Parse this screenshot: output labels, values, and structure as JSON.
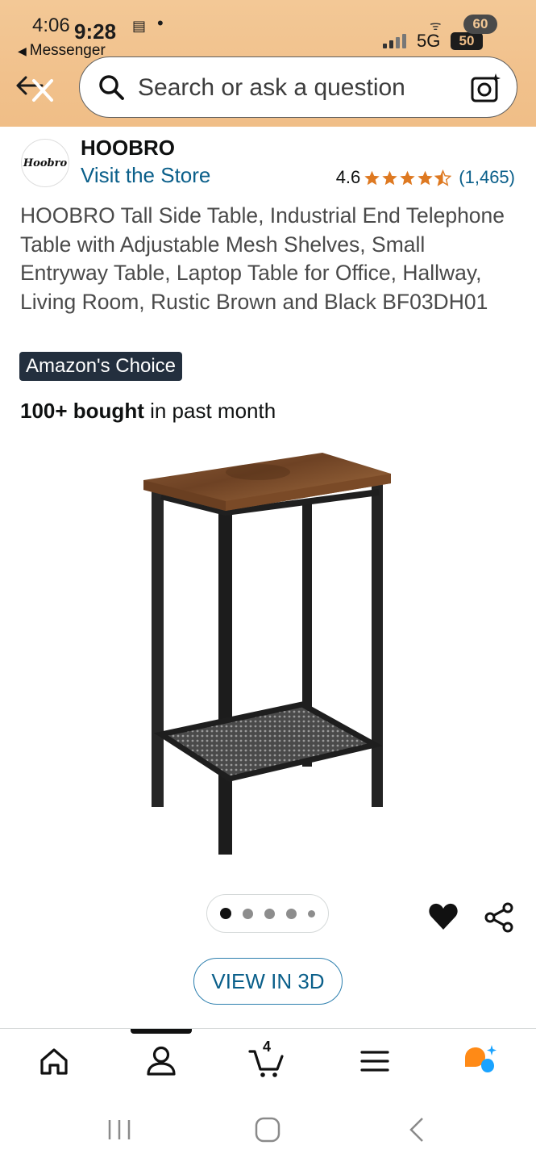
{
  "status_bar": {
    "time_background": "4:06",
    "time_overlay": "9:28",
    "back_app_label": "Messenger",
    "network_label": "5G",
    "battery_top": "60",
    "battery_bottom": "50"
  },
  "search": {
    "placeholder": "Search or ask a question"
  },
  "brand": {
    "logo_text": "Hoobro",
    "name": "HOOBRO",
    "store_link": "Visit the Store",
    "rating": "4.6",
    "stars": 4.5,
    "review_count": "(1,465)"
  },
  "product": {
    "title": "HOOBRO Tall Side Table, Industrial End Telephone Table with Adjustable Mesh Shelves, Small Entryway Table, Laptop Table for Office, Hallway, Living Room, Rustic Brown and Black BF03DH01",
    "badge": "Amazon's Choice",
    "bought_bold": "100+ bought",
    "bought_rest": " in past month",
    "image_icon": "side-table-image"
  },
  "gallery": {
    "dot_count": 5,
    "active_index": 0,
    "view_3d_label": "VIEW IN 3D"
  },
  "bottom_nav": {
    "items": [
      {
        "icon": "home-icon"
      },
      {
        "icon": "account-icon"
      },
      {
        "icon": "cart-icon",
        "count": "4"
      },
      {
        "icon": "menu-icon"
      },
      {
        "icon": "rufus-assistant-icon"
      }
    ],
    "active_index": 1
  },
  "colors": {
    "header_bg": "#f3c896",
    "link_blue": "#0a5f8a",
    "star_orange": "#de7921",
    "badge_bg": "#232f3e",
    "assistant_orange": "#ff8a16",
    "assistant_blue": "#1aa3ff"
  }
}
